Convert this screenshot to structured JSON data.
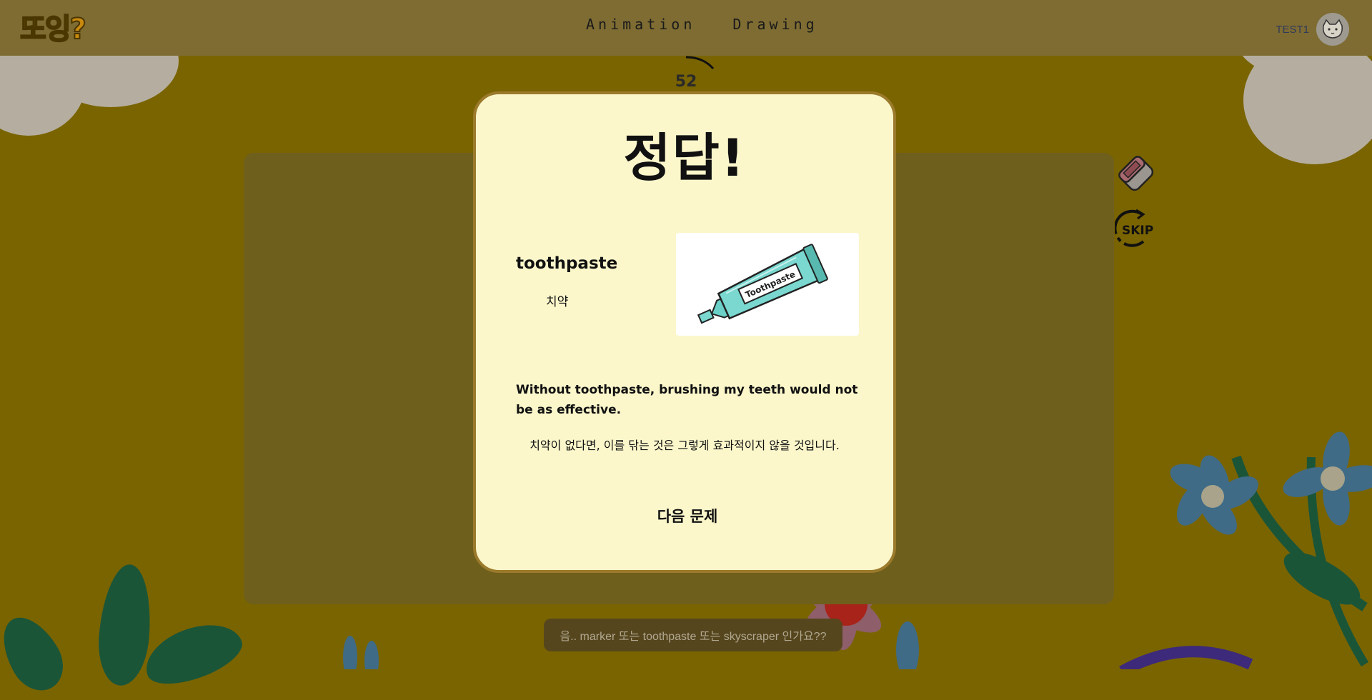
{
  "header": {
    "logo_text": "또잉?",
    "nav": [
      "Animation",
      "Drawing"
    ],
    "username": "TEST1",
    "avatar_icon": "cat-avatar-icon"
  },
  "game": {
    "timer": "52",
    "tools": {
      "eraser_icon": "eraser-icon",
      "skip_label": "SKIP"
    }
  },
  "modal": {
    "title": "정답!",
    "word": "toothpaste",
    "word_ko": "치약",
    "image": {
      "label": "Toothpaste",
      "icon": "toothpaste-tube-icon"
    },
    "sentence_en": "Without toothpaste, brushing my teeth would not be as effective.",
    "sentence_ko": "치약이 없다면, 이를 닦는 것은 그렇게 효과적이지 않을 것입니다.",
    "next_button": "다음 문제"
  },
  "chat": {
    "message": "음.. marker 또는 toothpaste 또는 skyscraper 인가요??"
  },
  "colors": {
    "background": "#7a6400",
    "header": "#7e6c33",
    "modal_bg": "#fbf7cb",
    "modal_border": "#9b7a2c",
    "logo": "#c98a10"
  }
}
